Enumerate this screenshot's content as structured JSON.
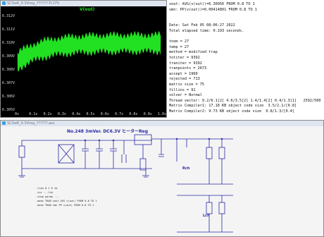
{
  "wave_window": {
    "title": "SC0w6_0.3Vreg_??????.Tr.CFS",
    "trace_name": "V(out)",
    "y_ticks": [
      "6.312V",
      "6.311V",
      "6.310V",
      "6.309V",
      "6.308V",
      "6.307V",
      "6.306V",
      "6.305V"
    ],
    "x_ticks": [
      "0s",
      "0.1s",
      "0.2s",
      "0.3s",
      "0.4s",
      "0.5s",
      "0.6s",
      "0.7s",
      "0.8s",
      "0.9s",
      "1.0s"
    ],
    "trace_color": "#22e022"
  },
  "log": {
    "lines": [
      "vout: AVG(v(out))=6.30956 FROM 0.8 TO 1",
      "vmn: PP(v(out))=0.00414801 FROM 0.8 TO 1",
      "",
      "",
      "Date: Sat Feb 05 08:06:27 2022",
      "Total elapsed time: 0.193 seconds.",
      "",
      "tnom = 27",
      "temp = 27",
      "method = modified trap",
      "totiter = 9392",
      "traniter = 9392",
      "tranpoints = 2673",
      "accept = 1960",
      "rejected = 713",
      "matrix size = 75",
      "fillins = 91",
      "solver = Normal",
      "Thread vector: 9.2/6.1[2] 4.6/3.5[2] 1.4/1.4[2] 0.4/1.3[1]   2592/500",
      "Matrix Compiler1: 17.18 KB object code size  3.5/2.1/[0.8]",
      "Matrix Compiler2: 9.73 KB object code size  0.8/1.3/[0.4]"
    ]
  },
  "sch_window": {
    "title": "SC0w6_0.3Vreg_??????.asc",
    "heading": "No.248 3mVer. DC6.3V ヒーターReg",
    "label_rch": "Rch",
    "label_lch": "Lch",
    "directives": [
      ".tran 0 1 0 1m",
      ".inc ...lib",
      ".step param ...",
      ".meas TRAN vout AVG v(out) FROM 0.8 TO 1",
      ".meas TRAN vmn PP v(out) FROM 0.8 TO 1"
    ]
  }
}
